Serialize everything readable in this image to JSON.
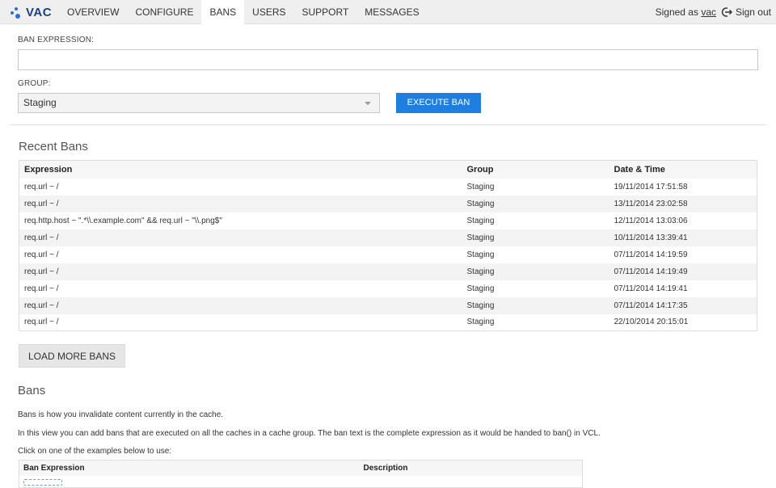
{
  "app": {
    "name": "VAC",
    "brand_color": "#2a6fdb",
    "accent_color": "#1e7fe0"
  },
  "nav": {
    "items": [
      {
        "label": "OVERVIEW"
      },
      {
        "label": "CONFIGURE"
      },
      {
        "label": "BANS",
        "active": true
      },
      {
        "label": "USERS"
      },
      {
        "label": "SUPPORT"
      },
      {
        "label": "MESSAGES"
      }
    ],
    "signed_prefix": "Signed as",
    "user": "vac",
    "signout_label": "Sign out"
  },
  "form": {
    "ban_expression_label": "BAN EXPRESSION:",
    "ban_expression_value": "",
    "group_label": "GROUP:",
    "group_value": "Staging",
    "execute_label": "EXECUTE BAN"
  },
  "recent": {
    "title": "Recent Bans",
    "columns": [
      "Expression",
      "Group",
      "Date & Time"
    ],
    "rows": [
      {
        "expression": "req.url ~ /",
        "group": "Staging",
        "datetime": "19/11/2014 17:51:58"
      },
      {
        "expression": "req.url ~ /",
        "group": "Staging",
        "datetime": "13/11/2014 23:02:58"
      },
      {
        "expression": "req.http.host ~ \".*\\\\.example.com\" && req.url ~ \"\\\\.png$\"",
        "group": "Staging",
        "datetime": "12/11/2014 13:03:06"
      },
      {
        "expression": "req.url ~ /",
        "group": "Staging",
        "datetime": "10/11/2014 13:39:41"
      },
      {
        "expression": "req.url ~ /",
        "group": "Staging",
        "datetime": "07/11/2014 14:19:59"
      },
      {
        "expression": "req.url ~ /",
        "group": "Staging",
        "datetime": "07/11/2014 14:19:49"
      },
      {
        "expression": "req.url ~ /",
        "group": "Staging",
        "datetime": "07/11/2014 14:19:41"
      },
      {
        "expression": "req.url ~ /",
        "group": "Staging",
        "datetime": "07/11/2014 14:17:35"
      },
      {
        "expression": "req.url ~ /",
        "group": "Staging",
        "datetime": "22/10/2014 20:15:01"
      }
    ],
    "load_more_label": "LOAD MORE BANS"
  },
  "help": {
    "title": "Bans",
    "para1": "Bans is how you invalidate content currently in the cache.",
    "para2": "In this view you can add bans that are executed on all the caches in a cache group. The ban text is the complete expression as it would be handed to ban() in VCL.",
    "para3": "Click on one of the examples below to use:",
    "columns": [
      "Ban Expression",
      "Description"
    ]
  }
}
